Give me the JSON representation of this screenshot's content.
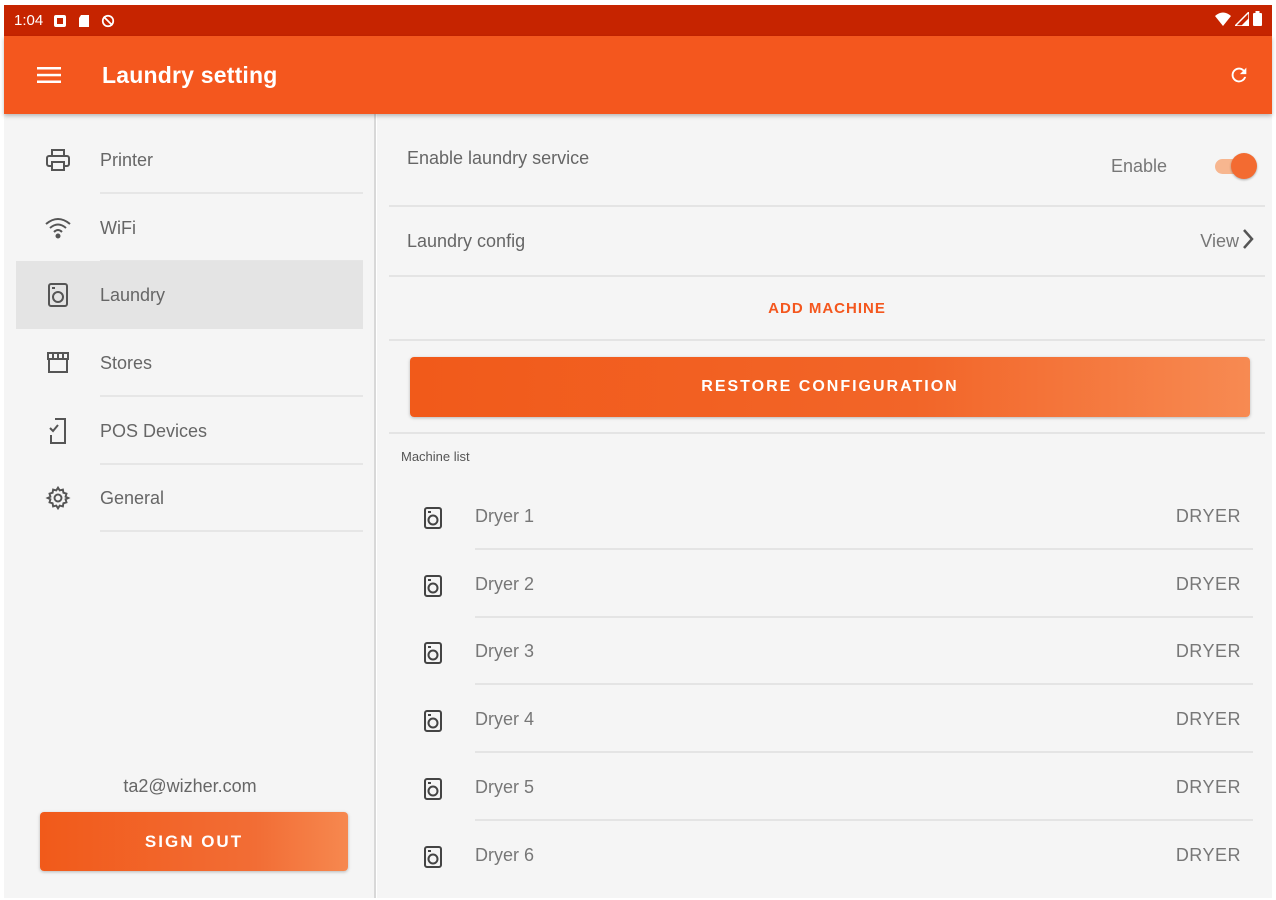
{
  "status_bar": {
    "time": "1:04"
  },
  "app_bar": {
    "title": "Laundry setting"
  },
  "sidebar": {
    "items": [
      {
        "label": "Printer",
        "icon": "printer-icon"
      },
      {
        "label": "WiFi",
        "icon": "wifi-icon"
      },
      {
        "label": "Laundry",
        "icon": "washer-icon",
        "active": true
      },
      {
        "label": "Stores",
        "icon": "store-icon"
      },
      {
        "label": "POS Devices",
        "icon": "pos-device-icon"
      },
      {
        "label": "General",
        "icon": "gear-icon"
      }
    ],
    "email": "ta2@wizher.com",
    "sign_out": "SIGN OUT"
  },
  "main": {
    "enable_label": "Enable laundry service",
    "enable_state_label": "Enable",
    "enabled": true,
    "config_label": "Laundry config",
    "config_action": "View",
    "add_machine": "ADD MACHINE",
    "restore": "RESTORE CONFIGURATION",
    "machine_list_label": "Machine list",
    "machines": [
      {
        "name": "Dryer 1",
        "type": "DRYER"
      },
      {
        "name": "Dryer 2",
        "type": "DRYER"
      },
      {
        "name": "Dryer 3",
        "type": "DRYER"
      },
      {
        "name": "Dryer 4",
        "type": "DRYER"
      },
      {
        "name": "Dryer 5",
        "type": "DRYER"
      },
      {
        "name": "Dryer 6",
        "type": "DRYER"
      }
    ]
  },
  "colors": {
    "primary": "#f4571e",
    "status_bar": "#c62400",
    "accent_light": "#f7b68f"
  }
}
